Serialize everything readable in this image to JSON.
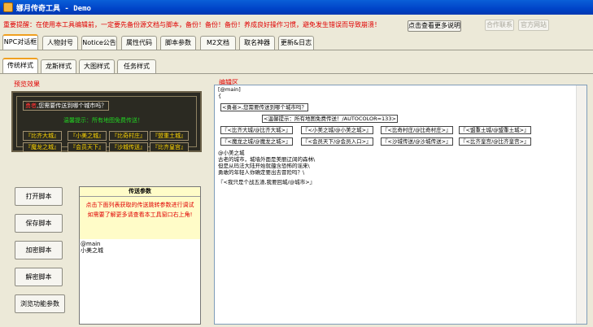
{
  "window": {
    "title": "娜月传奇工具 - Demo"
  },
  "header": {
    "notice": "重要提醒：在使用本工具编辑前，一定要先备份源文档与脚本，备份！备份！备份！养成良好操作习惯，避免发生错误而导致崩溃！",
    "more_button": "点击查看更多说明",
    "cooperate_button": "合作联系",
    "website_button": "官方网站"
  },
  "main_tabs": [
    "NPC对话框",
    "人物封号",
    "Notice公告",
    "属性代码",
    "脚本参数",
    "M2文档",
    "取名神器",
    "更新&日志"
  ],
  "sub_tabs": [
    "传统样式",
    "龙斯样式",
    "大图样式",
    "任务样式"
  ],
  "preview": {
    "label": "预览效果",
    "name": "勇者",
    "question": ",您需要传送到哪个城市吗？",
    "hint": "温馨提示：所有地图免费传送！",
    "options_row1": [
      "『比齐大城』",
      "『小美之城』",
      "『比奇村庄』",
      "『盟重土城』"
    ],
    "options_row2": [
      "『魔龙之城』",
      "『会员天下』",
      "『沙城传送』",
      "『比齐皇宫』"
    ]
  },
  "buttons": {
    "open_script": "打开脚本",
    "save_script": "保存脚本",
    "encrypt_script": "加密脚本",
    "decrypt_script": "解密脚本",
    "browse_params": "浏览功能参数"
  },
  "params": {
    "title": "传送参数",
    "note": "点击下面列表获取的传送跳转参数进行调试\n如需要了解更多请查看本工具窗口右上角!",
    "content": "@main\n小美之城"
  },
  "editor": {
    "label": "编辑区",
    "line_main": "[@main]",
    "line_brace": "{",
    "cell_hero": "<勇者>,您需要传送到哪个城市吗？",
    "cell_hint": "<温馨提示：所有地图免费传送！/AUTOCOLOR=133>",
    "row1": [
      "『<比齐大城/@比齐大城>』",
      "『<小美之城/@小美之城>』",
      "『<比奇村庄/@比奇村庄>』",
      "『<盟重土城/@盟重土城>』"
    ],
    "row2": [
      "『<魔龙之城/@魔龙之城>』",
      "『<会员天下/@会员入口>』",
      "『<沙城传送/@沙城传送>』",
      "『<比齐皇宫/@比齐皇宫>』"
    ],
    "line_city": "@小美之城",
    "line_desc1": "古老的城市，城墙外面是美丽辽阔的森林\\",
    "line_desc2": "但是从玛法大陆开始就蕴含恐怖的谣来\\",
    "line_desc3": "勇敢的年轻人你确定要出去冒险吗？\\",
    "line_back": "『<我只是个战五渣,我要回城/@城市>』"
  }
}
